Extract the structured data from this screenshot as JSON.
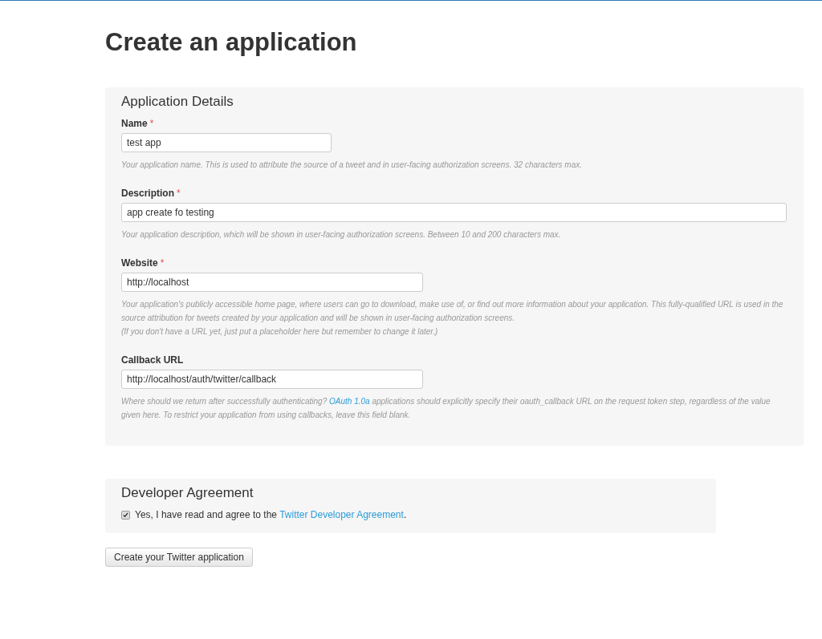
{
  "page_title": "Create an application",
  "details": {
    "title": "Application Details",
    "fields": [
      {
        "label": "Name",
        "required_mark": "*",
        "value": "test app",
        "help": [
          {
            "text": "Your application name. This is used to attribute the source of a tweet and in user-facing authorization screens. 32 characters max."
          }
        ]
      },
      {
        "label": "Description",
        "required_mark": "*",
        "value": "app create fo testing",
        "help": [
          {
            "text": "Your application description, which will be shown in user-facing authorization screens. Between 10 and 200 characters max."
          }
        ]
      },
      {
        "label": "Website",
        "required_mark": "*",
        "value": "http://localhost",
        "help": [
          {
            "text": "Your application's publicly accessible home page, where users can go to download, make use of, or find out more information about your application. This fully-qualified URL is used in the source attribution for tweets created by your application and will be shown in user-facing authorization screens."
          },
          {
            "text": "(If you don't have a URL yet, just put a placeholder here but remember to change it later.)"
          }
        ]
      },
      {
        "label": "Callback URL",
        "value": "http://localhost/auth/twitter/callback",
        "help": [
          {
            "text": "Where should we return after successfully authenticating? ",
            "link": "OAuth 1.0a",
            "after": " applications should explicitly specify their oauth_callback URL on the request token step, regardless of the value given here. To restrict your application from using callbacks, leave this field blank."
          }
        ]
      }
    ]
  },
  "agreement": {
    "title": "Developer Agreement",
    "checked": true,
    "text": "Yes, I have read and agree to the ",
    "link": "Twitter Developer Agreement",
    "after": "."
  },
  "submit_button": "Create your Twitter application"
}
